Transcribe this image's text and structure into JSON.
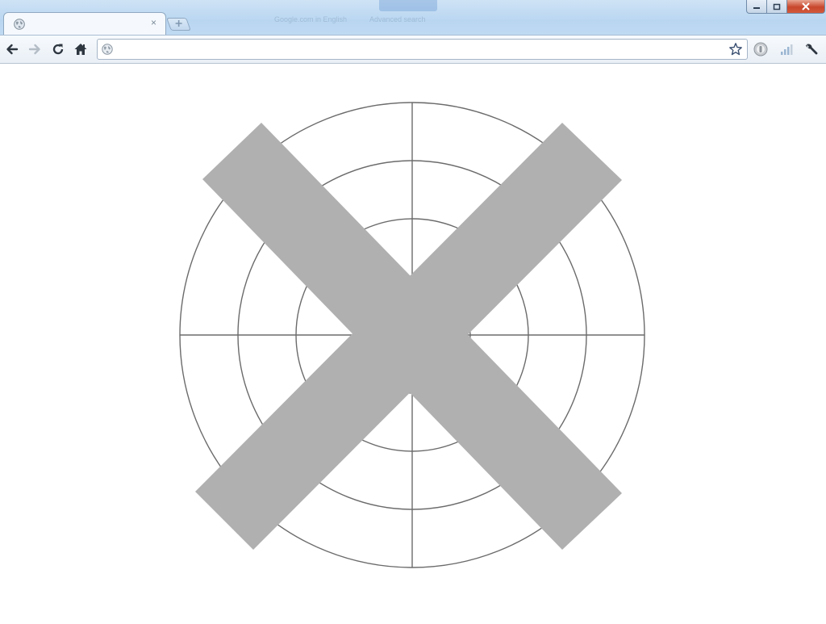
{
  "browser": {
    "title_bar": {
      "ghost_text_left": "Google.com in English",
      "ghost_text_right": "Advanced search"
    },
    "tab": {
      "title": "",
      "favicon": "globe-icon",
      "close_glyph": "×"
    },
    "new_tab_icon": "plus-icon",
    "window_controls": [
      "minimize-icon",
      "maximize-icon",
      "close-icon"
    ],
    "toolbar": {
      "buttons": [
        "back-arrow-icon",
        "forward-arrow-icon",
        "reload-icon",
        "home-icon"
      ],
      "address": {
        "value": "",
        "placeholder": ""
      },
      "right_icons": [
        "bookmark-star-icon",
        "extension-icon",
        "signal-icon",
        "wrench-icon"
      ]
    }
  },
  "page": {
    "graphic": {
      "type": "polar-grid-with-cross",
      "ring_count": 4,
      "spoke_count": 4,
      "grid_color": "#6b6b6b",
      "cross_color": "#b0b0b0"
    }
  }
}
